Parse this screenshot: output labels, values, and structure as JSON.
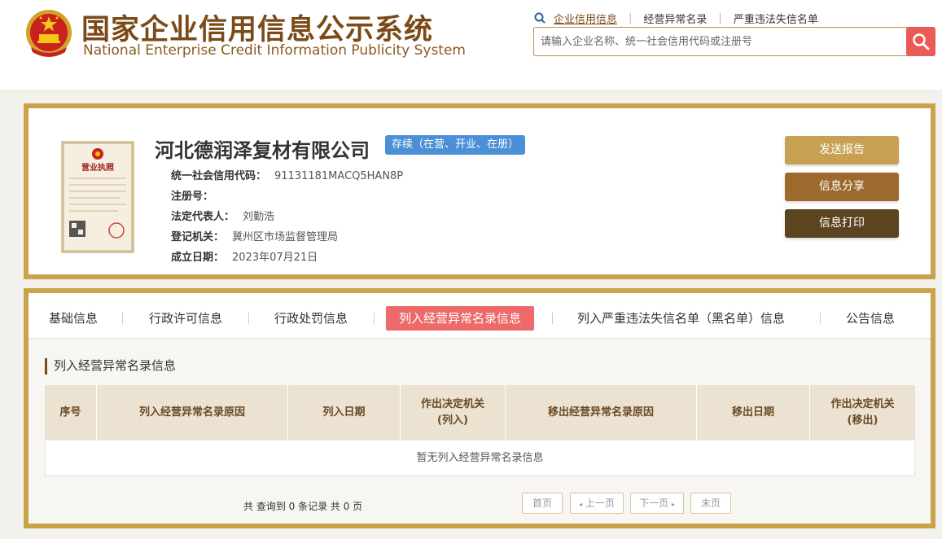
{
  "header": {
    "title_cn": "国家企业信用信息公示系统",
    "title_en": "National Enterprise Credit Information Publicity System",
    "nav": [
      "企业信用信息",
      "经营异常名录",
      "严重违法失信名单"
    ],
    "search_placeholder": "请输入企业名称、统一社会信用代码或注册号"
  },
  "company": {
    "name": "河北德润泽复材有限公司",
    "status": "存续（在营、开业、在册）",
    "license_title": "营业执照",
    "fields": [
      {
        "label": "统一社会信用代码：",
        "value": "91131181MACQ5HAN8P"
      },
      {
        "label": "注册号：",
        "value": ""
      },
      {
        "label": "法定代表人：",
        "value": "刘勤浩"
      },
      {
        "label": "登记机关：",
        "value": "冀州区市场监督管理局"
      },
      {
        "label": "成立日期：",
        "value": "2023年07月21日"
      }
    ],
    "actions": [
      "发送报告",
      "信息分享",
      "信息打印"
    ]
  },
  "tabs": [
    "基础信息",
    "行政许可信息",
    "行政处罚信息",
    "列入经营异常名录信息",
    "列入严重违法失信名单（黑名单）信息",
    "公告信息"
  ],
  "section": {
    "title": "列入经营异常名录信息",
    "columns": [
      "序号",
      "列入经营异常名录原因",
      "列入日期",
      "作出决定机关\n(列入)",
      "移出经营异常名录原因",
      "移出日期",
      "作出决定机关\n(移出)"
    ],
    "empty_text": "暂无列入经营异常名录信息"
  },
  "pager": {
    "info": "共 查询到 0 条记录 共 0 页",
    "first": "首页",
    "prev": "上一页",
    "next": "下一页",
    "last": "末页"
  },
  "colors": {
    "gold_border": "#c9a24a",
    "brown_title": "#7a4a18",
    "active_tab": "#ee6a6a",
    "search_button": "#e95b56",
    "status_blue": "#4b8fd6"
  }
}
